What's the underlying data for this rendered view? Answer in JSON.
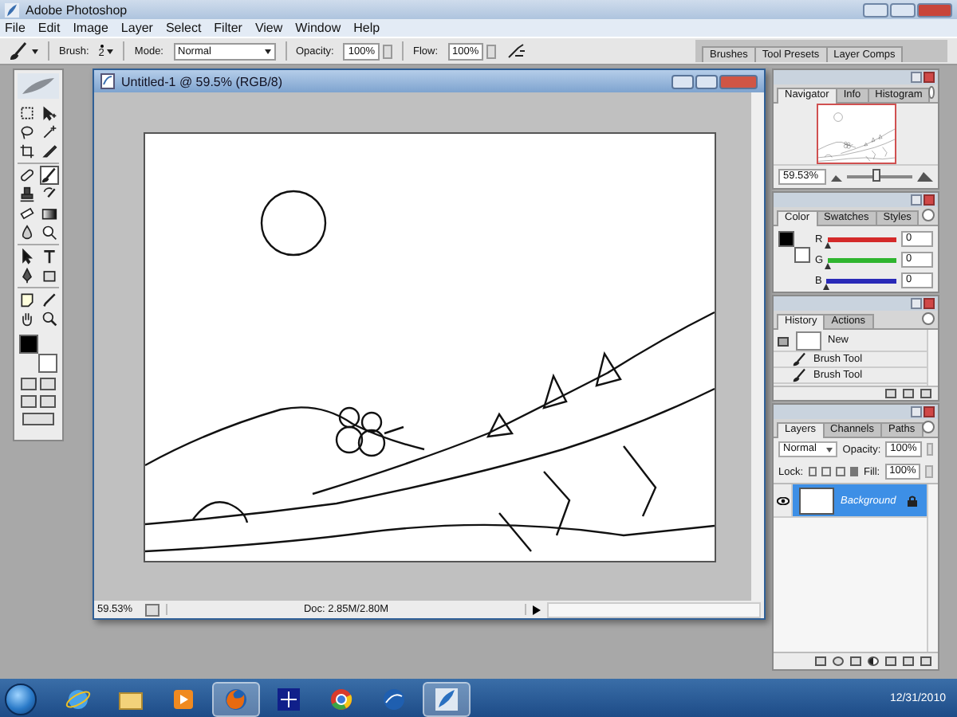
{
  "app": {
    "title": "Adobe Photoshop"
  },
  "menu": [
    {
      "label": "File"
    },
    {
      "label": "Edit"
    },
    {
      "label": "Image"
    },
    {
      "label": "Layer"
    },
    {
      "label": "Select"
    },
    {
      "label": "Filter"
    },
    {
      "label": "View"
    },
    {
      "label": "Window"
    },
    {
      "label": "Help"
    }
  ],
  "options_bar": {
    "brush_label": "Brush:",
    "brush_size": "2",
    "mode_label": "Mode:",
    "mode": "Normal",
    "opacity_label": "Opacity:",
    "opacity": "100%",
    "flow_label": "Flow:",
    "flow": "100%"
  },
  "palette_well": [
    {
      "label": "Brushes",
      "selected": false
    },
    {
      "label": "Tool Presets",
      "selected": false
    },
    {
      "label": "Layer Comps",
      "selected": false
    }
  ],
  "toolbox": {
    "tools": [
      {
        "kind": "marquee",
        "selected": false
      },
      {
        "kind": "move",
        "selected": false
      },
      {
        "kind": "lasso",
        "selected": false
      },
      {
        "kind": "wand",
        "selected": false
      },
      {
        "kind": "crop",
        "selected": false
      },
      {
        "kind": "slice",
        "selected": false
      },
      {
        "kind": "healing",
        "selected": false
      },
      {
        "kind": "brush",
        "selected": true
      },
      {
        "kind": "stamp",
        "selected": false
      },
      {
        "kind": "history_brush",
        "selected": false
      },
      {
        "kind": "eraser",
        "selected": false
      },
      {
        "kind": "gradient",
        "selected": false
      },
      {
        "kind": "blur",
        "selected": false
      },
      {
        "kind": "dodge",
        "selected": false
      },
      {
        "kind": "path_select",
        "selected": false
      },
      {
        "kind": "type",
        "selected": false
      },
      {
        "kind": "pen",
        "selected": false
      },
      {
        "kind": "shape",
        "selected": false
      },
      {
        "kind": "notes",
        "selected": false
      },
      {
        "kind": "eyedropper",
        "selected": false
      },
      {
        "kind": "hand",
        "selected": false
      },
      {
        "kind": "zoom",
        "selected": false
      }
    ],
    "swatches": [
      {
        "kind": "foreground",
        "color": "#000000"
      },
      {
        "kind": "background",
        "color": "#ffffff"
      }
    ]
  },
  "document": {
    "title": "Untitled-1 @ 59.5% (RGB/8)",
    "zoom": "59.53%",
    "doc_size": "Doc: 2.85M/2.80M"
  },
  "navigator": {
    "tabs": [
      {
        "label": "Navigator",
        "selected": true
      },
      {
        "label": "Info",
        "selected": false
      },
      {
        "label": "Histogram",
        "selected": false
      }
    ],
    "zoom": "59.53%",
    "level": 0.45
  },
  "color": {
    "tabs": [
      {
        "label": "Color",
        "selected": true
      },
      {
        "label": "Swatches",
        "selected": false
      },
      {
        "label": "Styles",
        "selected": false
      }
    ],
    "swatches": [
      {
        "kind": "foreground",
        "color": "#000000"
      },
      {
        "kind": "background",
        "color": "#ffffff"
      }
    ],
    "channels": [
      {
        "label": "R",
        "value": "0",
        "color": "#d42a2a",
        "level": 0
      },
      {
        "label": "G",
        "value": "0",
        "color": "#2fb52f",
        "level": 0
      },
      {
        "label": "B",
        "value": "0",
        "color": "#2a2ab8",
        "level": 0
      }
    ]
  },
  "history": {
    "tabs": [
      {
        "label": "History",
        "selected": true
      },
      {
        "label": "Actions",
        "selected": false
      }
    ],
    "snapshot": "New",
    "items": [
      {
        "label": "Brush Tool"
      },
      {
        "label": "Brush Tool"
      }
    ]
  },
  "layers": {
    "tabs": [
      {
        "label": "Layers",
        "selected": true
      },
      {
        "label": "Channels",
        "selected": false
      },
      {
        "label": "Paths",
        "selected": false
      }
    ],
    "blend_mode": "Normal",
    "opacity_label": "Opacity:",
    "opacity": "100%",
    "lock_label": "Lock:",
    "fill_label": "Fill:",
    "fill": "100%",
    "layers": [
      {
        "name": "Background",
        "selected": true,
        "visible": true,
        "locked": true
      }
    ]
  },
  "taskbar": {
    "apps": [
      {
        "kind": "ie",
        "active": false
      },
      {
        "kind": "explorer",
        "active": false
      },
      {
        "kind": "media",
        "active": false
      },
      {
        "kind": "firefox",
        "active": true
      },
      {
        "kind": "stars",
        "active": false
      },
      {
        "kind": "chrome",
        "active": false
      },
      {
        "kind": "earth",
        "active": false
      },
      {
        "kind": "photoshop",
        "active": true
      }
    ],
    "clock": "12/31/2010"
  }
}
